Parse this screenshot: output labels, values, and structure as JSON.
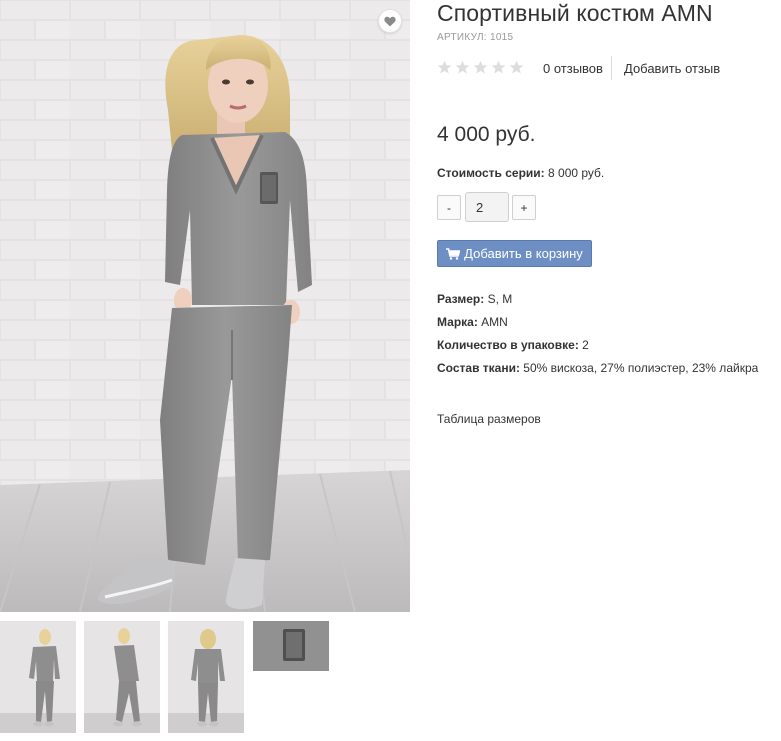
{
  "product": {
    "title": "Спортивный костюм AMN",
    "sku": "АРТИКУЛ: 1015",
    "price": "4 000 руб.",
    "series_label": "Стоимость серии:",
    "series_value": "8 000 руб."
  },
  "rating": {
    "stars_filled": 0,
    "stars_total": 5,
    "reviews_count": "0 отзывов",
    "add_review": "Добавить отзыв"
  },
  "quantity": {
    "minus": "-",
    "plus": "+",
    "value": "2"
  },
  "cart": {
    "button_label": "Добавить в корзину",
    "icon": "cart-icon"
  },
  "properties": [
    {
      "label": "Размер:",
      "value": "S, M"
    },
    {
      "label": "Марка:",
      "value": "AMN"
    },
    {
      "label": "Количество в упаковке:",
      "value": "2"
    },
    {
      "label": "Состав ткани:",
      "value": "50% вискоза, 27% полиэстер, 23% лайкра"
    }
  ],
  "links": {
    "size_table": "Таблица размеров"
  },
  "colors": {
    "cart_button": "#6e8fc4",
    "star_empty": "#dddddd",
    "suit_gray": "#8e8e8e",
    "background": "#ffffff"
  },
  "gallery": {
    "wishlist_icon": "heart-icon",
    "thumbnail_count": 4
  }
}
